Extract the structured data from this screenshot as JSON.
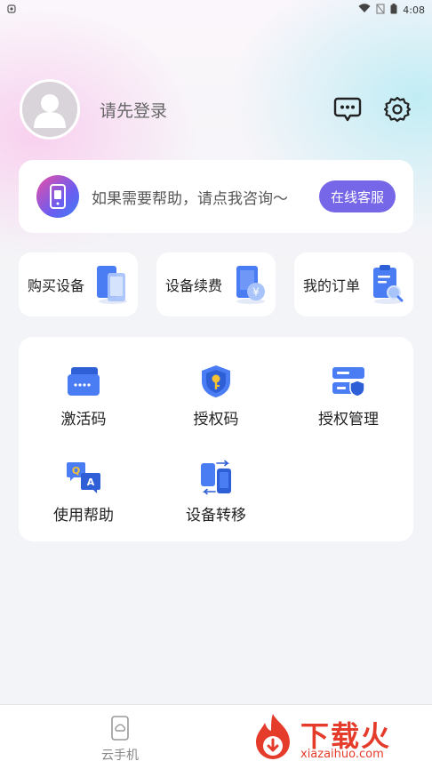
{
  "status_bar": {
    "time": "4:08"
  },
  "profile": {
    "login_prompt": "请先登录"
  },
  "help": {
    "message": "如果需要帮助，请点我咨询～",
    "button_label": "在线客服"
  },
  "quick_actions": [
    {
      "label": "购买设备",
      "icon": "phone-stack-icon"
    },
    {
      "label": "设备续费",
      "icon": "phone-yen-icon"
    },
    {
      "label": "我的订单",
      "icon": "clipboard-search-icon"
    }
  ],
  "features": [
    {
      "label": "激活码",
      "icon": "card-code-icon"
    },
    {
      "label": "授权码",
      "icon": "shield-key-icon"
    },
    {
      "label": "授权管理",
      "icon": "server-shield-icon"
    },
    {
      "label": "使用帮助",
      "icon": "qa-chat-icon"
    },
    {
      "label": "设备转移",
      "icon": "device-transfer-icon"
    }
  ],
  "bottom_nav": {
    "cloud_phone_label": "云手机"
  },
  "watermark": {
    "brand": "下载火",
    "domain": "xiazaihuo.com"
  },
  "colors": {
    "accent": "#7666e8",
    "brand_blue": "#4a7df4",
    "watermark": "#e53b2b"
  }
}
